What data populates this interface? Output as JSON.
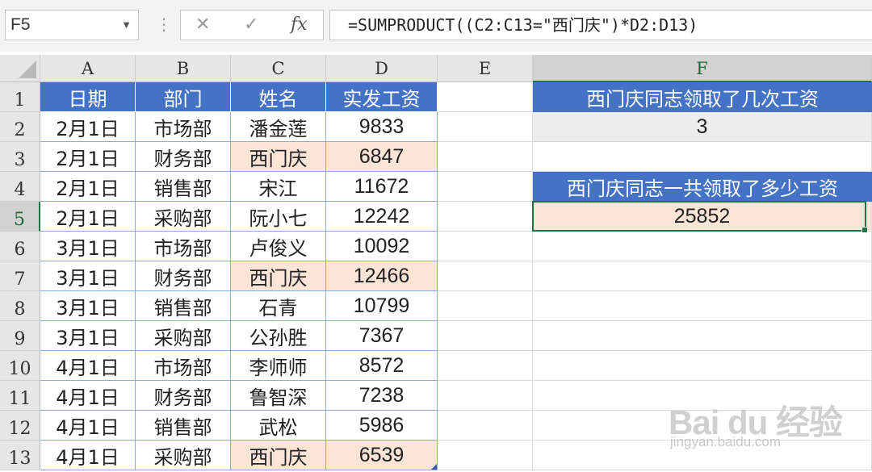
{
  "name_box": {
    "value": "F5"
  },
  "formula_bar": {
    "cancel_icon": "✕",
    "enter_icon": "✓",
    "fx_label": "fx",
    "formula": "=SUMPRODUCT((C2:C13=\"西门庆\")*D2:D13)"
  },
  "columns": [
    "A",
    "B",
    "C",
    "D",
    "E",
    "F"
  ],
  "rows": [
    "1",
    "2",
    "3",
    "4",
    "5",
    "6",
    "7",
    "8",
    "9",
    "10",
    "11",
    "12",
    "13"
  ],
  "table": {
    "headers": [
      "日期",
      "部门",
      "姓名",
      "实发工资"
    ],
    "rows": [
      [
        "2月1日",
        "市场部",
        "潘金莲",
        "9833"
      ],
      [
        "2月1日",
        "财务部",
        "西门庆",
        "6847"
      ],
      [
        "2月1日",
        "销售部",
        "宋江",
        "11672"
      ],
      [
        "2月1日",
        "采购部",
        "阮小七",
        "12242"
      ],
      [
        "3月1日",
        "市场部",
        "卢俊义",
        "10092"
      ],
      [
        "3月1日",
        "财务部",
        "西门庆",
        "12466"
      ],
      [
        "3月1日",
        "销售部",
        "石青",
        "10799"
      ],
      [
        "3月1日",
        "采购部",
        "公孙胜",
        "7367"
      ],
      [
        "4月1日",
        "市场部",
        "李师师",
        "8572"
      ],
      [
        "4月1日",
        "财务部",
        "鲁智深",
        "7238"
      ],
      [
        "4月1日",
        "销售部",
        "武松",
        "5986"
      ],
      [
        "4月1日",
        "采购部",
        "西门庆",
        "6539"
      ]
    ]
  },
  "summary": {
    "q1_title": "西门庆同志领取了几次工资",
    "q1_value": "3",
    "q2_title": "西门庆同志一共领取了多少工资",
    "q2_value": "25852"
  },
  "colors": {
    "header_blue": "#4472c4",
    "highlight_peach": "#fce4d6",
    "selection_green": "#217346"
  },
  "watermark": {
    "text": "Bai du 经验",
    "sub": "jingyan.baidu.com"
  }
}
